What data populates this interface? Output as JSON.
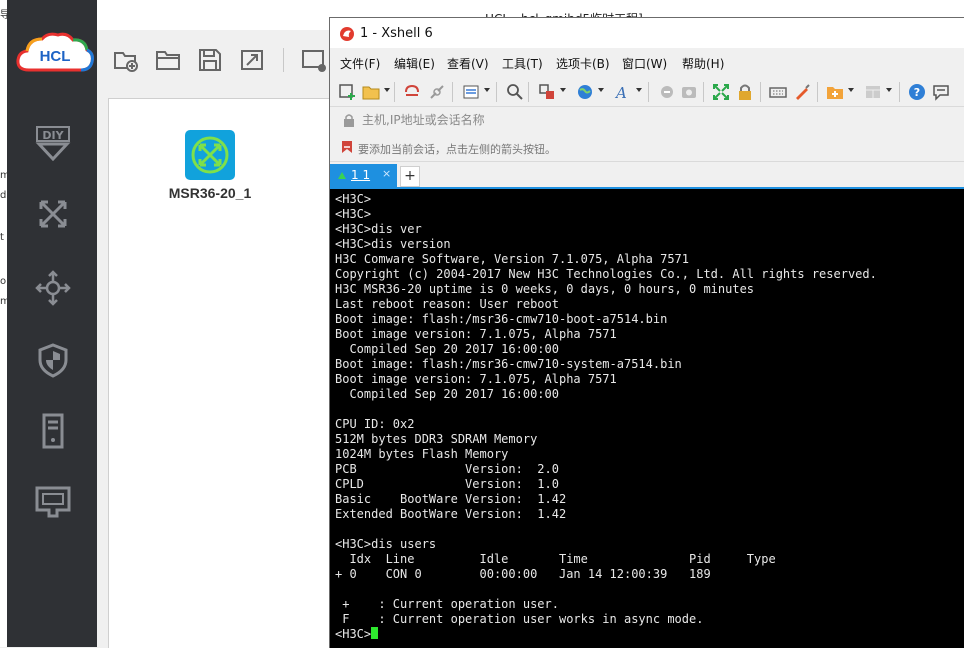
{
  "colors": {
    "hcl_sidebar": "#2f3135",
    "device_icon": "#11a2dc",
    "xshell_accent": "#1e90e0",
    "terminal_bg": "#000000",
    "terminal_fg": "#e8e8e8",
    "cursor": "#2ee82e"
  },
  "hcl": {
    "window_title": "HCL - hcl_gmjhd5临时工程]",
    "logo_text": "HCL",
    "sidebar_icons": [
      "diy-icon",
      "switch-icon",
      "router-icon",
      "firewall-icon",
      "server-icon",
      "terminal-pc-icon"
    ],
    "toolbar_icons": [
      "new-project-icon",
      "open-folder-icon",
      "save-icon",
      "export-icon",
      "cli-icon"
    ],
    "device": {
      "name": "MSR36-20_1",
      "icon": "router-icon"
    },
    "edge_fragments": [
      "导",
      "m",
      "d",
      "t",
      "o",
      "m"
    ]
  },
  "xshell": {
    "title": "1 - Xshell 6",
    "menu": [
      "文件(F)",
      "编辑(E)",
      "查看(V)",
      "工具(T)",
      "选项卡(B)",
      "窗口(W)",
      "帮助(H)"
    ],
    "toolbar_icons": [
      "new-session-icon",
      "open-icon",
      "reconnect-icon",
      "disconnect-icon",
      "properties-icon",
      "find-icon",
      "transfer-icon",
      "globe-icon",
      "font-icon",
      "script-icon",
      "screenshot-icon",
      "fullscreen-icon",
      "lock-icon",
      "keyboard-icon",
      "highlight-icon",
      "new-tab-icon",
      "layout-icon",
      "help-icon",
      "chat-icon"
    ],
    "address_placeholder": "主机,IP地址或会话名称",
    "hint": "要添加当前会话，点击左侧的箭头按钮。",
    "tabs": [
      {
        "label": "1 1",
        "close": "×"
      }
    ],
    "add_tab": "+",
    "terminal_lines": [
      "<H3C>",
      "<H3C>",
      "<H3C>dis ver",
      "<H3C>dis version",
      "H3C Comware Software, Version 7.1.075, Alpha 7571",
      "Copyright (c) 2004-2017 New H3C Technologies Co., Ltd. All rights reserved.",
      "H3C MSR36-20 uptime is 0 weeks, 0 days, 0 hours, 0 minutes",
      "Last reboot reason: User reboot",
      "Boot image: flash:/msr36-cmw710-boot-a7514.bin",
      "Boot image version: 7.1.075, Alpha 7571",
      "  Compiled Sep 20 2017 16:00:00",
      "Boot image: flash:/msr36-cmw710-system-a7514.bin",
      "Boot image version: 7.1.075, Alpha 7571",
      "  Compiled Sep 20 2017 16:00:00",
      "",
      "CPU ID: 0x2",
      "512M bytes DDR3 SDRAM Memory",
      "1024M bytes Flash Memory",
      "PCB               Version:  2.0",
      "CPLD              Version:  1.0",
      "Basic    BootWare Version:  1.42",
      "Extended BootWare Version:  1.42",
      "",
      "<H3C>dis users",
      "  Idx  Line         Idle       Time              Pid     Type",
      "+ 0    CON 0        00:00:00   Jan 14 12:00:39   189",
      "",
      " +    : Current operation user.",
      " F    : Current operation user works in async mode."
    ],
    "prompt": "<H3C>"
  }
}
